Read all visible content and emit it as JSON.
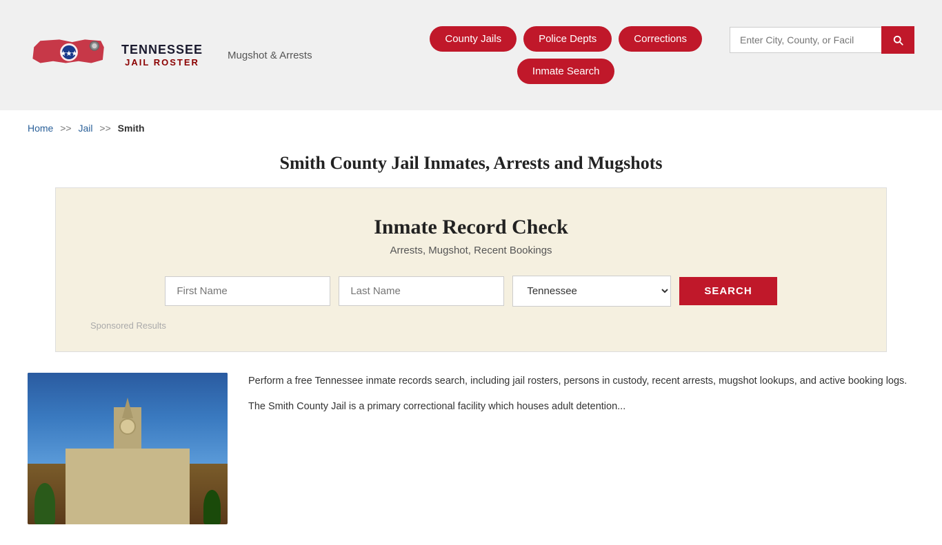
{
  "header": {
    "logo_subtitle": "Mugshot & Arrests",
    "logo_title_line1": "TENNESSEE",
    "logo_title_line2": "JAIL ROSTER",
    "search_placeholder": "Enter City, County, or Facil"
  },
  "nav": {
    "county_jails": "County Jails",
    "police_depts": "Police Depts",
    "corrections": "Corrections",
    "inmate_search": "Inmate Search"
  },
  "breadcrumb": {
    "home": "Home",
    "sep1": ">>",
    "jail": "Jail",
    "sep2": ">>",
    "current": "Smith"
  },
  "page": {
    "title": "Smith County Jail Inmates, Arrests and Mugshots"
  },
  "record_check": {
    "heading": "Inmate Record Check",
    "subtitle": "Arrests, Mugshot, Recent Bookings",
    "first_name_placeholder": "First Name",
    "last_name_placeholder": "Last Name",
    "state_default": "Tennessee",
    "search_button": "SEARCH",
    "sponsored": "Sponsored Results"
  },
  "bottom": {
    "paragraph1": "Perform a free Tennessee inmate records search, including jail rosters, persons in custody, recent arrests, mugshot lookups, and active booking logs.",
    "paragraph2": "The Smith County Jail is a primary correctional facility which houses adult detention..."
  }
}
